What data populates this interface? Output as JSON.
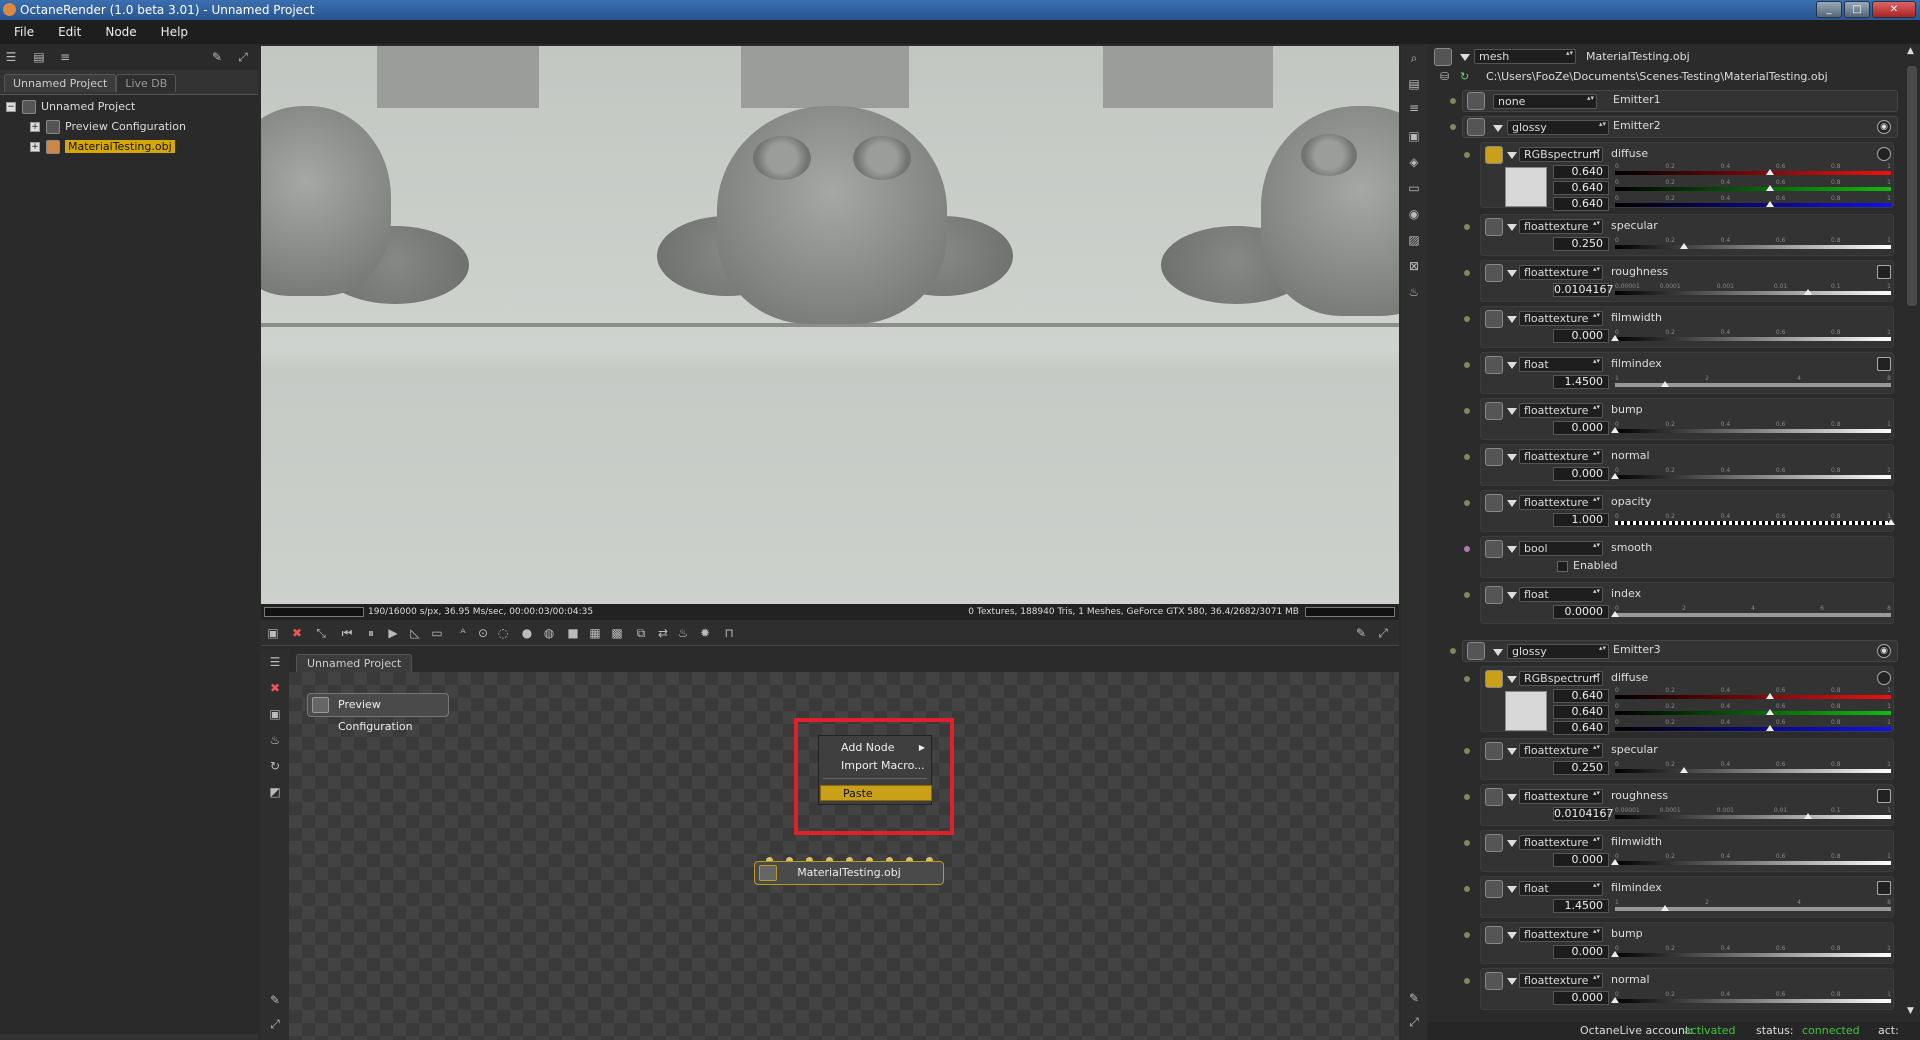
{
  "window": {
    "title": "OctaneRender (1.0 beta 3.01) - Unnamed Project"
  },
  "menu": [
    "File",
    "Edit",
    "Node",
    "Help"
  ],
  "left": {
    "tabs": [
      "Unnamed Project",
      "Live DB"
    ],
    "tree": [
      {
        "label": "Unnamed Project"
      },
      {
        "label": "Preview Configuration"
      },
      {
        "label": "MaterialTesting.obj"
      }
    ]
  },
  "render": {
    "stats_left": "190/16000 s/px, 36.95 Ms/sec, 00:00:03/00:04:35",
    "stats_right": "0 Textures, 188940 Tris, 1 Meshes, GeForce GTX 580, 36.4/2682/3071 MB"
  },
  "nodegraph": {
    "tab": "Unnamed Project",
    "preview_node": "Preview Configuration",
    "mesh_node": "MaterialTesting.obj",
    "context_menu": {
      "add_node": "Add Node",
      "import_macro": "Import Macro...",
      "paste": "Paste"
    }
  },
  "inspector": {
    "header": {
      "type": "mesh",
      "name": "MaterialTesting.obj",
      "path": "C:\\Users\\FooZe\\Documents\\Scenes-Testing\\MaterialTesting.obj"
    },
    "emitter1": {
      "type": "none",
      "name": "Emitter1"
    },
    "emitter2": {
      "type": "glossy",
      "name": "Emitter2",
      "diffuse": {
        "type": "RGBspectrum",
        "name": "diffuse",
        "r": "0.640",
        "g": "0.640",
        "b": "0.640"
      },
      "params": [
        {
          "type": "floattexture",
          "name": "specular",
          "value": "0.250",
          "marker": 0.25
        },
        {
          "type": "floattexture",
          "name": "roughness",
          "value": "0.0104167",
          "marker": 0.7
        },
        {
          "type": "floattexture",
          "name": "filmwidth",
          "value": "0.000",
          "marker": 0.0
        },
        {
          "type": "float",
          "name": "filmindex",
          "value": "1.4500",
          "marker": 0.18
        },
        {
          "type": "floattexture",
          "name": "bump",
          "value": "0.000",
          "marker": 0.0
        },
        {
          "type": "floattexture",
          "name": "normal",
          "value": "0.000",
          "marker": 0.0
        },
        {
          "type": "floattexture",
          "name": "opacity",
          "value": "1.000",
          "marker": 1.0
        }
      ],
      "smooth": {
        "type": "bool",
        "name": "smooth",
        "label": "Enabled"
      },
      "index": {
        "type": "float",
        "name": "index",
        "value": "0.0000",
        "marker": 0.0
      }
    },
    "emitter3": {
      "type": "glossy",
      "name": "Emitter3",
      "diffuse": {
        "type": "RGBspectrum",
        "name": "diffuse",
        "r": "0.640",
        "g": "0.640",
        "b": "0.640"
      },
      "params": [
        {
          "type": "floattexture",
          "name": "specular",
          "value": "0.250",
          "marker": 0.25
        },
        {
          "type": "floattexture",
          "name": "roughness",
          "value": "0.0104167",
          "marker": 0.7
        },
        {
          "type": "floattexture",
          "name": "filmwidth",
          "value": "0.000",
          "marker": 0.0
        },
        {
          "type": "float",
          "name": "filmindex",
          "value": "1.4500",
          "marker": 0.18
        },
        {
          "type": "floattexture",
          "name": "bump",
          "value": "0.000",
          "marker": 0.0
        },
        {
          "type": "floattexture",
          "name": "normal",
          "value": "0.000",
          "marker": 0.0
        }
      ]
    }
  },
  "scales": {
    "linear": [
      "0",
      "0.2",
      "0.4",
      "0.6",
      "0.8",
      "1"
    ],
    "log": [
      "0.00001",
      "0.0001",
      "0.001",
      "0.01",
      "0.1",
      "1"
    ],
    "index": [
      "1",
      "2",
      "4",
      "8"
    ],
    "index2": [
      "0",
      "2",
      "4",
      "6",
      "8"
    ]
  },
  "status": {
    "account_label": "OctaneLive account:",
    "account_value": "activated",
    "status_label": "status:",
    "status_value": "connected",
    "act": "act:"
  },
  "colors": {
    "selection": "#d6a900",
    "paste_highlight": "#c9a017",
    "annotation_box": "#e0202a",
    "activated": "#3cc83c"
  }
}
